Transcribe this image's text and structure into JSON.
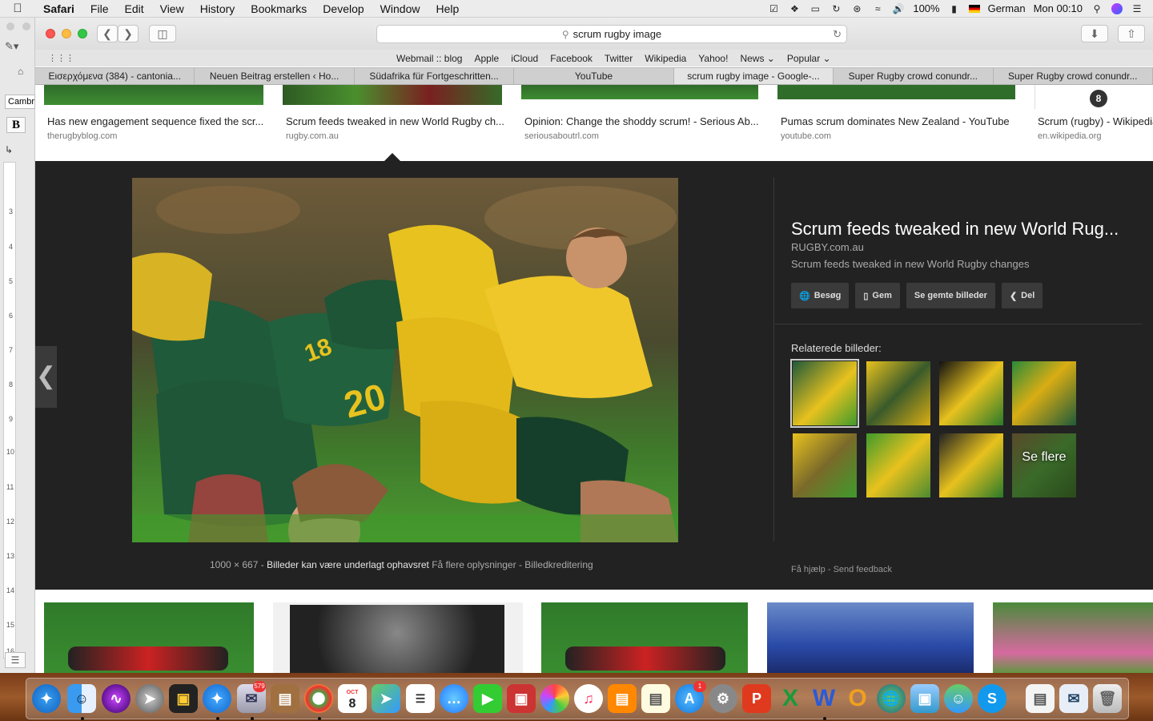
{
  "menubar": {
    "items": [
      "Safari",
      "File",
      "Edit",
      "View",
      "History",
      "Bookmarks",
      "Develop",
      "Window",
      "Help"
    ],
    "battery": "100%",
    "input_source": "German",
    "clock": "Mon 00:10"
  },
  "word_window": {
    "font_box": "Cambr",
    "bold_button": "B",
    "ruler_numbers": [
      "3",
      "4",
      "5",
      "6",
      "7",
      "8",
      "9",
      "10",
      "11",
      "12",
      "13",
      "14",
      "15",
      "16"
    ]
  },
  "toolbar": {
    "address": "scrum rugby image"
  },
  "favorites": [
    "Webmail :: blog",
    "Apple",
    "iCloud",
    "Facebook",
    "Twitter",
    "Wikipedia",
    "Yahoo!",
    "News ⌄",
    "Popular ⌄"
  ],
  "tabs": [
    {
      "label": "Εισερχόμενα (384) - cantonia...",
      "active": false
    },
    {
      "label": "Neuen Beitrag erstellen ‹ Ho...",
      "active": false
    },
    {
      "label": "Südafrika für Fortgeschritten...",
      "active": false
    },
    {
      "label": "YouTube",
      "active": false
    },
    {
      "label": "scrum rugby image - Google-...",
      "active": true
    },
    {
      "label": "Super Rugby crowd conundr...",
      "active": false
    },
    {
      "label": "Super Rugby crowd conundr...",
      "active": false
    }
  ],
  "top_results": [
    {
      "title": "Has new engagement sequence fixed the scr...",
      "source": "therugbyblog.com"
    },
    {
      "title": "Scrum feeds tweaked in new World Rugby ch...",
      "source": "rugby.com.au"
    },
    {
      "title": "Opinion: Change the shoddy scrum! - Serious Ab...",
      "source": "seriousaboutrl.com"
    },
    {
      "title": "Pumas scrum dominates New Zealand - YouTube",
      "source": "youtube.com"
    },
    {
      "title": "Scrum (rugby) - Wikipedia",
      "source": "en.wikipedia.org",
      "badge": "8"
    }
  ],
  "preview": {
    "title": "Scrum feeds tweaked in new World Rug...",
    "domain": "RUGBY.com.au",
    "description": "Scrum feeds tweaked in new World Rugby changes",
    "actions": [
      "Besøg",
      "Gem",
      "Se gemte billeder",
      "Del"
    ],
    "related_label": "Relaterede billeder:",
    "see_more": "Se flere",
    "caption": {
      "dimensions": "1000 × 667",
      "copyright": "Billeder kan være underlagt ophavsret",
      "more_info": "Få flere oplysninger",
      "credit": "Billedkreditering"
    },
    "footer": {
      "help": "Få hjælp",
      "feedback": "Send feedback"
    }
  },
  "dock": {
    "mail_badge": "579",
    "calendar_month": "OCT",
    "calendar_day": "8",
    "appstore_badge": "1"
  }
}
